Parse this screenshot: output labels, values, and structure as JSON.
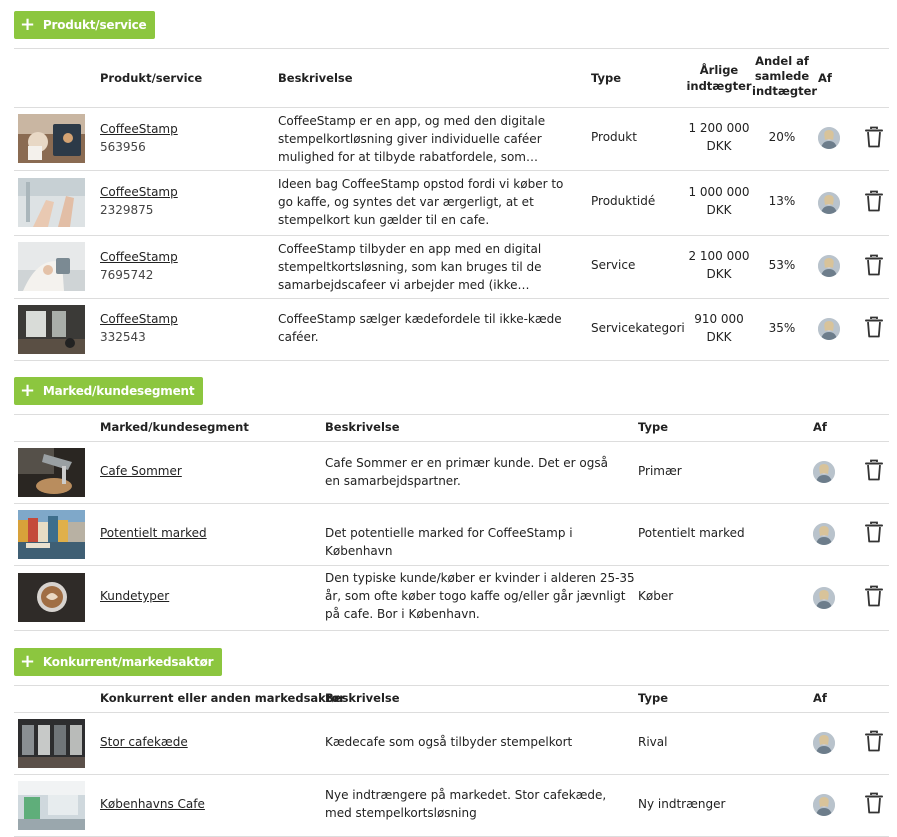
{
  "products": {
    "add_label": "Produkt/service",
    "headers": {
      "name": "Produkt/service",
      "desc": "Beskrivelse",
      "type": "Type",
      "income": "Årlige indtægter",
      "share": "Andel af samlede indtægter",
      "by": "Af"
    },
    "rows": [
      {
        "name": "CoffeeStamp",
        "id": "563956",
        "desc": "CoffeeStamp er en app, og med den digitale stempelkortløsning giver individuelle caféer mulighed for at tilbyde rabatfordele, som…",
        "type": "Produkt",
        "income": "1 200 000 DKK",
        "share": "20%"
      },
      {
        "name": "CoffeeStamp",
        "id": "2329875",
        "desc": "Ideen bag CoffeeStamp opstod fordi vi køber to go kaffe, og syntes det var ærgerligt, at et stempelkort kun gælder til en cafe.",
        "type": "Produktidé",
        "income": "1 000 000 DKK",
        "share": "13%"
      },
      {
        "name": "CoffeeStamp",
        "id": "7695742",
        "desc": "CoffeeStamp tilbyder en app med en digital stempeltkortsløsning, som kan bruges til de samarbejdscafeer vi arbejder med (ikke…",
        "type": "Service",
        "income": "2 100 000 DKK",
        "share": "53%"
      },
      {
        "name": "CoffeeStamp",
        "id": "332543",
        "desc": "CoffeeStamp sælger kædefordele til ikke-kæde caféer.",
        "type": "Servicekategori",
        "income": "910 000 DKK",
        "share": "35%"
      }
    ]
  },
  "markets": {
    "add_label": "Marked/kundesegment",
    "headers": {
      "name": "Marked/kundesegment",
      "desc": "Beskrivelse",
      "type": "Type",
      "by": "Af"
    },
    "rows": [
      {
        "name": "Cafe Sommer",
        "desc": "Cafe Sommer er en primær kunde. Det er også en samarbejdspartner.",
        "type": "Primær"
      },
      {
        "name": "Potentielt marked",
        "desc": "Det potentielle marked for CoffeeStamp i København",
        "type": "Potentielt marked"
      },
      {
        "name": "Kundetyper",
        "desc": "Den typiske kunde/køber er kvinder i alderen 25-35 år, som ofte køber togo kaffe og/eller går jævnligt på cafe. Bor i København.",
        "type": "Køber"
      }
    ]
  },
  "competitors": {
    "add_label": "Konkurrent/markedsaktør",
    "headers": {
      "name": "Konkurrent eller anden markedsaktør",
      "desc": "Beskrivelse",
      "type": "Type",
      "by": "Af"
    },
    "rows": [
      {
        "name": "Stor cafekæde",
        "desc": "Kædecafe som også tilbyder stempelkort",
        "type": "Rival"
      },
      {
        "name": "Københavns Cafe",
        "desc": "Nye indtrængere på markedet. Stor cafekæde, med stempelkortsløsning",
        "type": "Ny indtrænger"
      }
    ]
  },
  "icons": {
    "add": "plus-icon",
    "delete": "trash-icon",
    "avatar": "user-avatar"
  },
  "colors": {
    "accent": "#8cc63f",
    "border": "#dddddd",
    "text": "#222222"
  }
}
